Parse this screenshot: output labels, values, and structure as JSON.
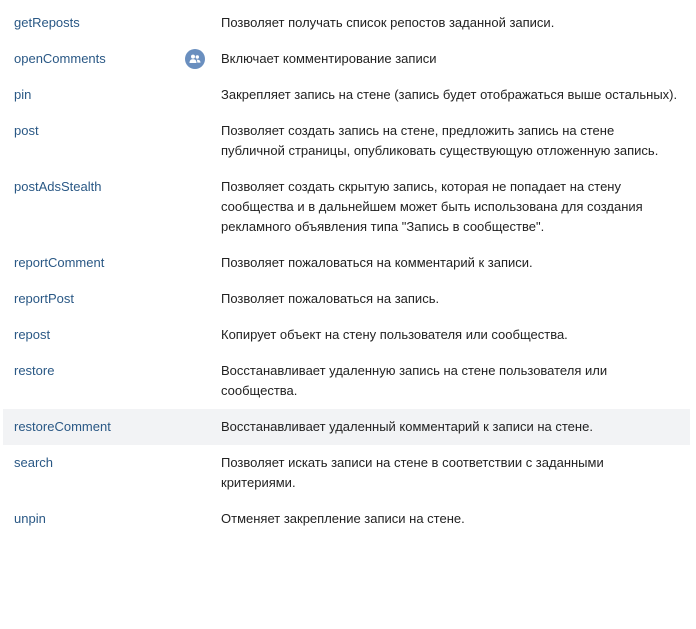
{
  "methods": [
    {
      "name": "getReposts",
      "description": "Позволяет получать список репостов заданной записи."
    },
    {
      "name": "openComments",
      "description": "Включает комментирование записи",
      "badge": "community-icon"
    },
    {
      "name": "pin",
      "description": "Закрепляет запись на стене (запись будет отображаться выше остальных)."
    },
    {
      "name": "post",
      "description": "Позволяет создать запись на стене, предложить запись на стене публичной страницы, опубликовать существующую отложенную запись."
    },
    {
      "name": "postAdsStealth",
      "description": "Позволяет создать скрытую запись, которая не попадает на стену сообщества и в дальнейшем может быть использована для создания рекламного объявления типа \"Запись в сообществе\"."
    },
    {
      "name": "reportComment",
      "description": "Позволяет пожаловаться на комментарий к записи."
    },
    {
      "name": "reportPost",
      "description": "Позволяет пожаловаться на запись."
    },
    {
      "name": "repost",
      "description": "Копирует объект на стену пользователя или сообщества."
    },
    {
      "name": "restore",
      "description": "Восстанавливает удаленную запись на стене пользователя или сообщества."
    },
    {
      "name": "restoreComment",
      "description": "Восстанавливает удаленный комментарий к записи на стене.",
      "highlighted": true
    },
    {
      "name": "search",
      "description": "Позволяет искать записи на стене в соответствии с заданными критериями."
    },
    {
      "name": "unpin",
      "description": "Отменяет закрепление записи на стене."
    }
  ],
  "colors": {
    "link": "#2a5885",
    "highlight": "#f2f3f5",
    "badge": "#6a8fbf"
  }
}
